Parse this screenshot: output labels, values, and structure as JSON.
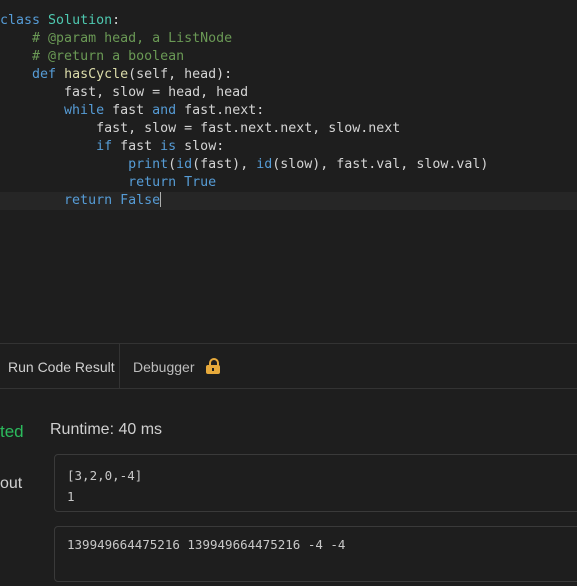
{
  "editor": {
    "lines": [
      {
        "indent": "",
        "tokens": [
          {
            "t": "class ",
            "c": "kw"
          },
          {
            "t": "Solution",
            "c": "cls"
          },
          {
            "t": ":",
            "c": ""
          }
        ]
      },
      {
        "indent": "    ",
        "tokens": [
          {
            "t": "# @param head, a ListNode",
            "c": "cm"
          }
        ]
      },
      {
        "indent": "    ",
        "tokens": [
          {
            "t": "# @return a boolean",
            "c": "cm"
          }
        ]
      },
      {
        "indent": "    ",
        "tokens": [
          {
            "t": "def ",
            "c": "kw"
          },
          {
            "t": "hasCycle",
            "c": "fn"
          },
          {
            "t": "(self, head):",
            "c": ""
          }
        ]
      },
      {
        "indent": "        ",
        "tokens": [
          {
            "t": "fast, slow = head, head",
            "c": ""
          }
        ]
      },
      {
        "indent": "        ",
        "tokens": [
          {
            "t": "while ",
            "c": "kw"
          },
          {
            "t": "fast ",
            "c": ""
          },
          {
            "t": "and ",
            "c": "kw"
          },
          {
            "t": "fast.next:",
            "c": ""
          }
        ]
      },
      {
        "indent": "            ",
        "tokens": [
          {
            "t": "fast, slow = fast.next.next, slow.next",
            "c": ""
          }
        ]
      },
      {
        "indent": "            ",
        "tokens": [
          {
            "t": "if ",
            "c": "kw"
          },
          {
            "t": "fast ",
            "c": ""
          },
          {
            "t": "is ",
            "c": "kw"
          },
          {
            "t": "slow:",
            "c": ""
          }
        ]
      },
      {
        "indent": "                ",
        "tokens": [
          {
            "t": "print",
            "c": "kw"
          },
          {
            "t": "(",
            "c": ""
          },
          {
            "t": "id",
            "c": "kw"
          },
          {
            "t": "(fast), ",
            "c": ""
          },
          {
            "t": "id",
            "c": "kw"
          },
          {
            "t": "(slow), fast.val, slow.val)",
            "c": ""
          }
        ]
      },
      {
        "indent": "                ",
        "tokens": [
          {
            "t": "return ",
            "c": "kw"
          },
          {
            "t": "True",
            "c": "kw"
          }
        ]
      },
      {
        "indent": "        ",
        "tokens": [
          {
            "t": "return ",
            "c": "kw"
          },
          {
            "t": "False",
            "c": "kw"
          }
        ]
      }
    ]
  },
  "panel": {
    "tabs": [
      {
        "label": "Run Code Result"
      },
      {
        "label": "Debugger"
      }
    ],
    "status": "ted",
    "runtime": "Runtime: 40 ms",
    "input_label": "out",
    "input_lines": [
      "[3,2,0,-4]",
      "1"
    ],
    "stdout": "139949664475216 139949664475216 -4 -4"
  },
  "colors": {
    "accepted": "#2cbb5d",
    "keyword": "#569cd6",
    "class": "#4ec9b0",
    "comment": "#6a9955",
    "lock": "#e6a93b"
  }
}
